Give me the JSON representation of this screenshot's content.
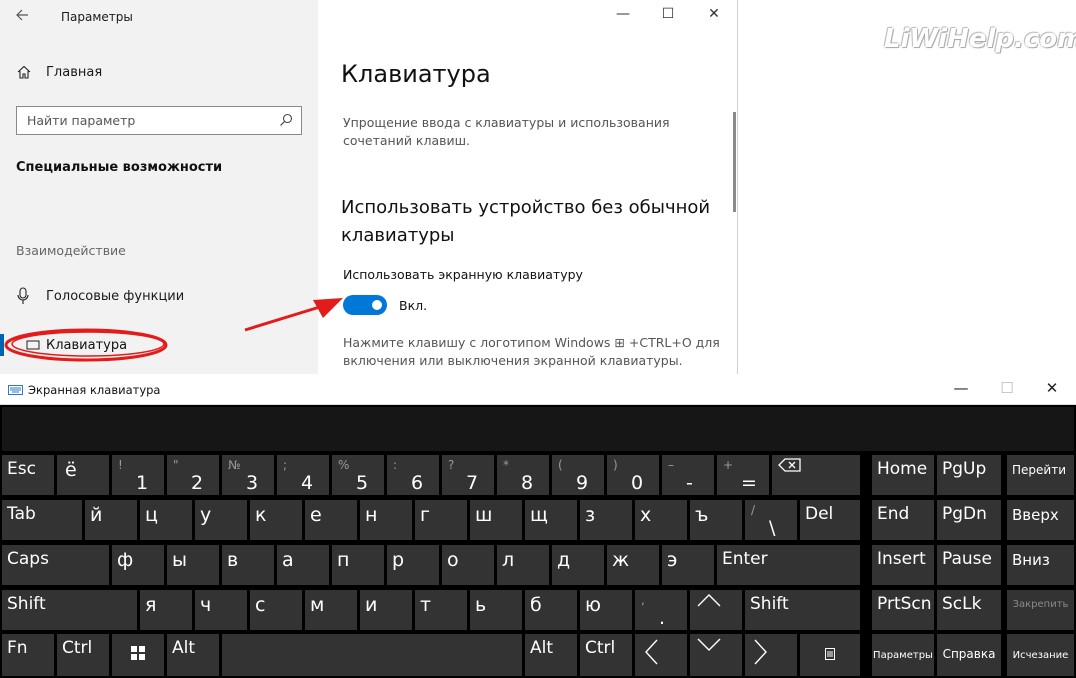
{
  "watermark": "LiWiHelp.com",
  "settings": {
    "window_title": "Параметры",
    "home_label": "Главная",
    "search_placeholder": "Найти параметр",
    "section_title": "Специальные возможности",
    "group_label": "Взаимодействие",
    "nav_voice": "Голосовые функции",
    "nav_keyboard": "Клавиатура",
    "page_title": "Клавиатура",
    "page_desc": "Упрощение ввода с клавиатуры и использования сочетаний клавиш.",
    "subheading": "Использовать устройство без обычной клавиатуры",
    "toggle_label": "Использовать экранную клавиатуру",
    "toggle_state": "Вкл.",
    "toggle_on": true,
    "hint": "Нажмите клавишу с логотипом Windows ⊞ +CTRL+O для включения или выключения экранной клавиатуры."
  },
  "osk": {
    "title": "Экранная клавиатура",
    "keys": {
      "esc": "Esc",
      "yo": "ё",
      "n1_top": "!",
      "n1": "1",
      "n2_top": "\"",
      "n2": "2",
      "n3_top": "№",
      "n3": "3",
      "n4_top": ";",
      "n4": "4",
      "n5_top": "%",
      "n5": "5",
      "n6_top": ":",
      "n6": "6",
      "n7_top": "?",
      "n7": "7",
      "n8_top": "*",
      "n8": "8",
      "n9_top": "(",
      "n9": "9",
      "n0_top": ")",
      "n0": "0",
      "minus_top": "–",
      "minus": "-",
      "eq_top": "+",
      "eq": "=",
      "home": "Home",
      "pgup": "PgUp",
      "nav": "Перейти",
      "tab": "Tab",
      "y": "й",
      "ts": "ц",
      "u": "у",
      "k": "к",
      "e": "е",
      "n": "н",
      "g": "г",
      "sh": "ш",
      "sch": "щ",
      "z": "з",
      "h": "х",
      "hard": "ъ",
      "bs_top": "/",
      "bs": "\\",
      "del": "Del",
      "end": "End",
      "pgdn": "PgDn",
      "up_txt": "Вверх",
      "caps": "Caps",
      "f": "ф",
      "yi": "ы",
      "v": "в",
      "a": "а",
      "p": "п",
      "r": "р",
      "o": "о",
      "l": "л",
      "d": "д",
      "zh": "ж",
      "ee": "э",
      "enter": "Enter",
      "insert": "Insert",
      "pause": "Pause",
      "down_txt": "Вниз",
      "shift": "Shift",
      "ya": "я",
      "ch": "ч",
      "s": "с",
      "m": "м",
      "i": "и",
      "t": "т",
      "soft": "ь",
      "b": "б",
      "yu": "ю",
      "dot_top": ",",
      "dot": ".",
      "shift_r": "Shift",
      "prtscn": "PrtScn",
      "sclk": "ScLk",
      "fix": "Закрепить",
      "fn": "Fn",
      "ctrl": "Ctrl",
      "alt": "Alt",
      "alt_r": "Alt",
      "ctrl_r": "Ctrl",
      "options": "Параметры",
      "help": "Справка",
      "fade": "Исчезание"
    }
  }
}
